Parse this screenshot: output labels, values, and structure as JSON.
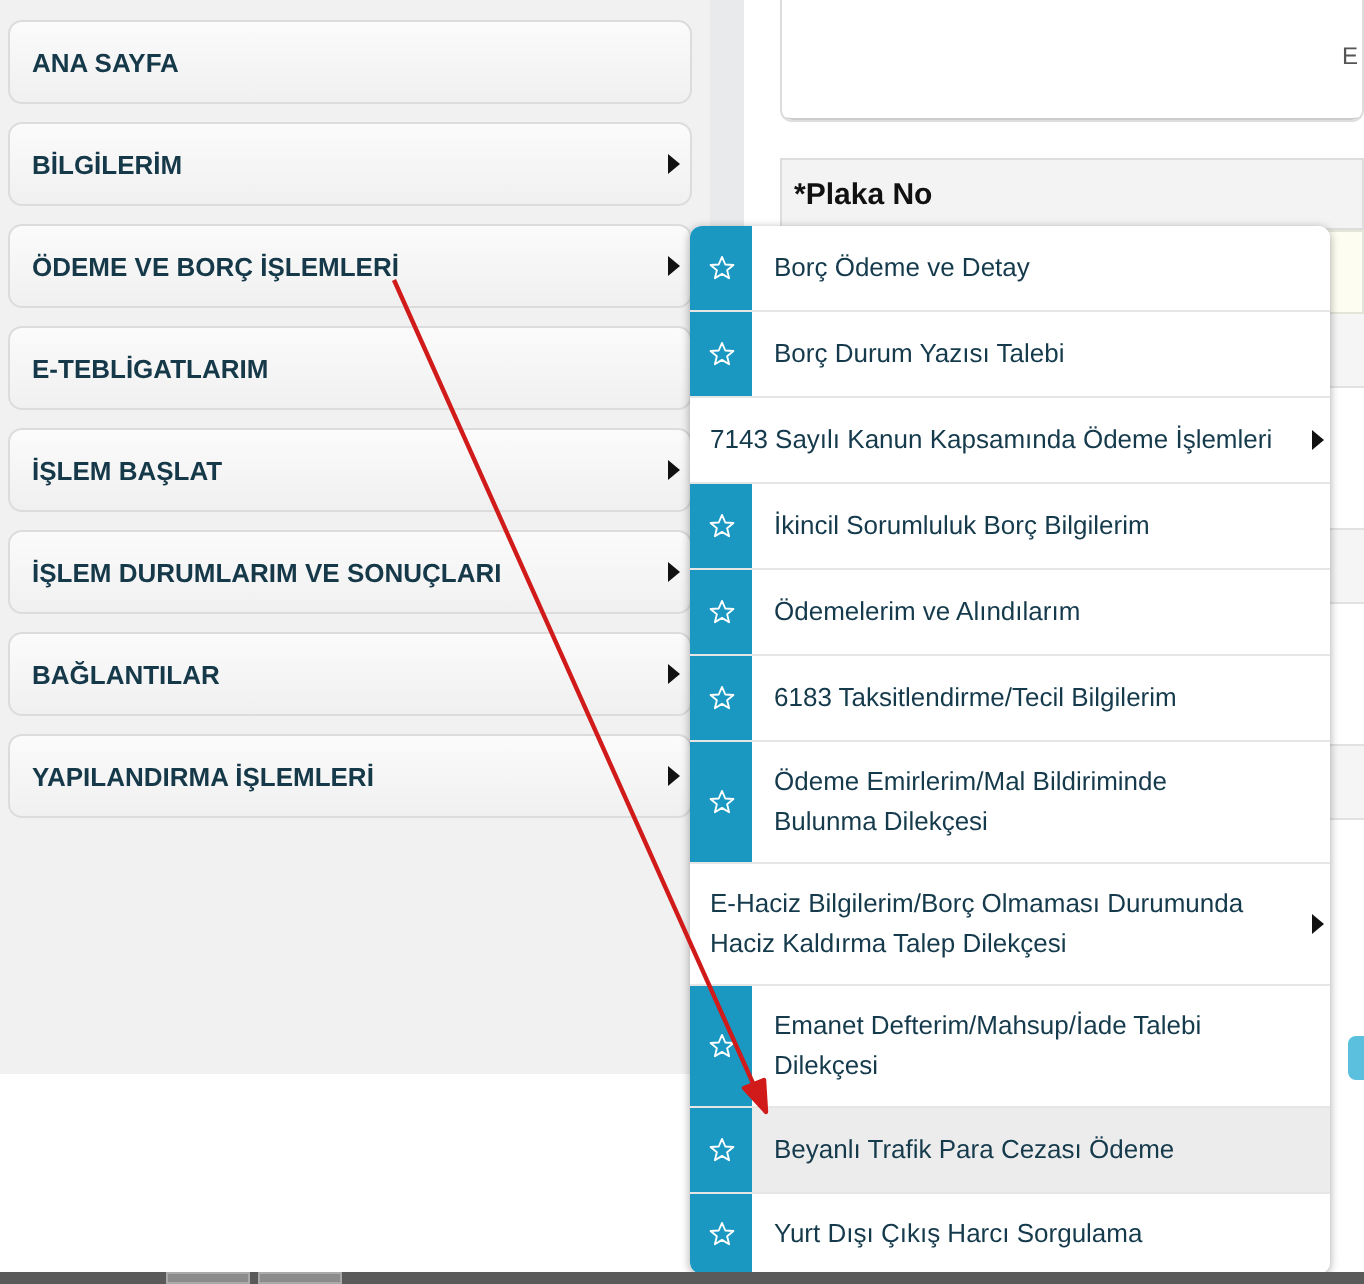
{
  "sidebar": {
    "items": [
      {
        "label": "ANA SAYFA",
        "has_submenu": false
      },
      {
        "label": "BİLGİLERİM",
        "has_submenu": true
      },
      {
        "label": "ÖDEME VE BORÇ İŞLEMLERİ",
        "has_submenu": true
      },
      {
        "label": "E-TEBLİGATLARIM",
        "has_submenu": false
      },
      {
        "label": "İŞLEM BAŞLAT",
        "has_submenu": true
      },
      {
        "label": "İŞLEM DURUMLARIM VE SONUÇLARI",
        "has_submenu": true
      },
      {
        "label": "BAĞLANTILAR",
        "has_submenu": true
      },
      {
        "label": "YAPILANDIRMA İŞLEMLERİ",
        "has_submenu": true
      }
    ]
  },
  "form": {
    "cut_text": "E",
    "field_label": "*Plaka No"
  },
  "submenu": {
    "items": [
      {
        "kind": "favorite",
        "label": "Borç Ödeme ve Detay",
        "highlighted": false
      },
      {
        "kind": "favorite",
        "label": "Borç Durum Yazısı Talebi",
        "highlighted": false
      },
      {
        "kind": "submenu",
        "label": "7143 Sayılı Kanun Kapsamında Ödeme İşlemleri",
        "highlighted": false
      },
      {
        "kind": "favorite",
        "label": "İkincil Sorumluluk Borç Bilgilerim",
        "highlighted": false
      },
      {
        "kind": "favorite",
        "label": "Ödemelerim ve Alındılarım",
        "highlighted": false
      },
      {
        "kind": "favorite",
        "label": "6183 Taksitlendirme/Tecil Bilgilerim",
        "highlighted": false
      },
      {
        "kind": "favorite",
        "label": "Ödeme Emirlerim/Mal Bildiriminde Bulunma Dilekçesi",
        "highlighted": false
      },
      {
        "kind": "submenu",
        "label": "E-Haciz Bilgilerim/Borç Olmaması Durumunda Haciz Kaldırma Talep Dilekçesi",
        "highlighted": false
      },
      {
        "kind": "favorite",
        "label": "Emanet Defterim/Mahsup/İade Talebi Dilekçesi",
        "highlighted": false
      },
      {
        "kind": "favorite",
        "label": "Beyanlı Trafik Para Cezası Ödeme",
        "highlighted": true
      },
      {
        "kind": "favorite",
        "label": "Yurt Dışı Çıkış Harcı Sorgulama",
        "highlighted": false
      }
    ]
  }
}
